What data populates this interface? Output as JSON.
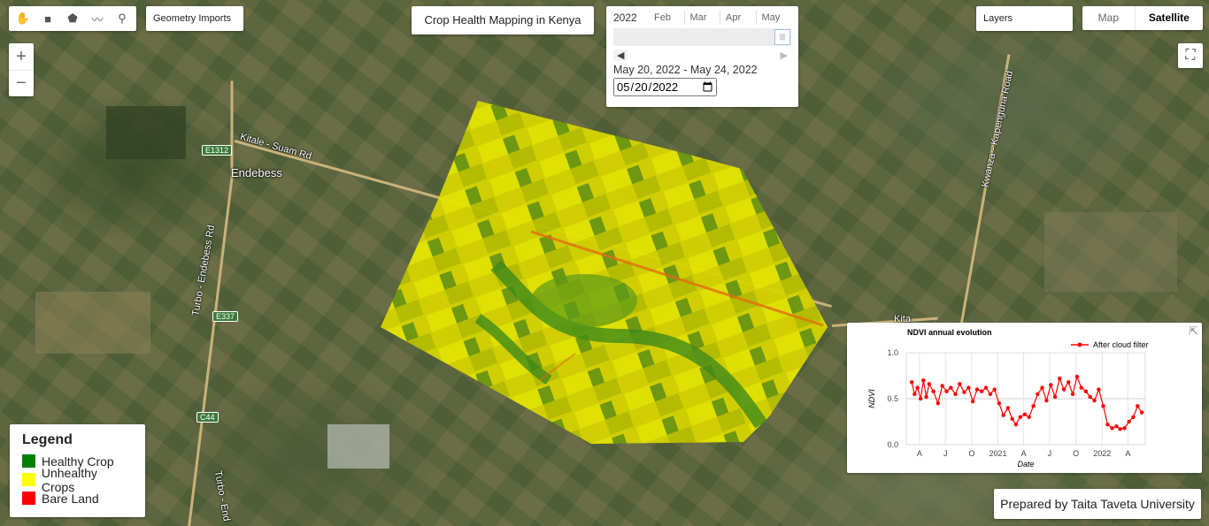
{
  "drawing_tools": {
    "tools": [
      {
        "name": "pan-hand-icon",
        "glyph": "✋"
      },
      {
        "name": "rectangle-icon",
        "glyph": "■"
      },
      {
        "name": "polygon-icon",
        "glyph": "⬟"
      },
      {
        "name": "line-icon",
        "glyph": "〰"
      },
      {
        "name": "marker-icon",
        "glyph": "⚲"
      }
    ],
    "imports_label": "Geometry Imports"
  },
  "title": "Crop Health Mapping in Kenya",
  "date_slider": {
    "year": "2022",
    "months": [
      "Feb",
      "Mar",
      "Apr",
      "May"
    ],
    "range_text": "May 20, 2022 - May 24, 2022",
    "date_value": "2022-05-20",
    "prev_glyph": "◀",
    "next_glyph": "▶",
    "handle_glyph": "|||"
  },
  "layers_label": "Layers",
  "map_type": {
    "map_label": "Map",
    "satellite_label": "Satellite",
    "selected": "Satellite"
  },
  "zoom": {
    "in_glyph": "+",
    "out_glyph": "−"
  },
  "fullscreen_glyph": "⛶",
  "map_labels": {
    "places": [
      "Endebess"
    ],
    "roads": [
      "Kitale - Suam Rd",
      "Turbo - Endebess Rd",
      "Kwanza - Kapenguria Road",
      "Kita",
      "Turbo - End"
    ],
    "shields": [
      "E1312",
      "E337",
      "C44"
    ]
  },
  "legend": {
    "title": "Legend",
    "items": [
      {
        "label": "Healthy Crop",
        "color": "#008000"
      },
      {
        "label": "Unhealthy Crops",
        "color": "#ffff00"
      },
      {
        "label": "Bare Land",
        "color": "#ff0000"
      }
    ]
  },
  "chart_panel": {
    "open_glyph": "⇱"
  },
  "chart_data": {
    "type": "line",
    "title": "NDVI annual evolution",
    "xlabel": "Date",
    "ylabel": "NDVI",
    "ylim": [
      0,
      1
    ],
    "yticks": [
      "0.0",
      "0.5",
      "1.0"
    ],
    "xticks": [
      "A",
      "J",
      "O",
      "2021",
      "A",
      "J",
      "O",
      "2022",
      "A"
    ],
    "series": [
      {
        "name": "After cloud filter",
        "color": "#ff0000",
        "x": [
          "2020-03-05",
          "2020-03-15",
          "2020-03-25",
          "2020-04-05",
          "2020-04-15",
          "2020-04-25",
          "2020-05-05",
          "2020-05-20",
          "2020-06-05",
          "2020-06-20",
          "2020-07-05",
          "2020-07-20",
          "2020-08-05",
          "2020-08-20",
          "2020-09-05",
          "2020-09-20",
          "2020-10-05",
          "2020-10-20",
          "2020-11-05",
          "2020-11-20",
          "2020-12-05",
          "2020-12-20",
          "2021-01-05",
          "2021-01-20",
          "2021-02-05",
          "2021-02-20",
          "2021-03-05",
          "2021-03-20",
          "2021-04-05",
          "2021-04-20",
          "2021-05-05",
          "2021-05-20",
          "2021-06-05",
          "2021-06-20",
          "2021-07-05",
          "2021-07-20",
          "2021-08-05",
          "2021-08-20",
          "2021-09-05",
          "2021-09-20",
          "2021-10-05",
          "2021-10-20",
          "2021-11-05",
          "2021-11-20",
          "2021-12-05",
          "2021-12-20",
          "2022-01-05",
          "2022-01-20",
          "2022-02-05",
          "2022-02-20",
          "2022-03-05",
          "2022-03-20",
          "2022-04-05",
          "2022-04-20",
          "2022-05-05",
          "2022-05-20"
        ],
        "y": [
          0.68,
          0.55,
          0.62,
          0.5,
          0.7,
          0.52,
          0.66,
          0.58,
          0.45,
          0.64,
          0.58,
          0.62,
          0.55,
          0.66,
          0.57,
          0.62,
          0.47,
          0.6,
          0.58,
          0.62,
          0.55,
          0.6,
          0.45,
          0.32,
          0.4,
          0.28,
          0.22,
          0.3,
          0.33,
          0.3,
          0.42,
          0.55,
          0.62,
          0.48,
          0.65,
          0.52,
          0.72,
          0.6,
          0.68,
          0.55,
          0.74,
          0.62,
          0.58,
          0.52,
          0.48,
          0.6,
          0.42,
          0.22,
          0.18,
          0.2,
          0.17,
          0.18,
          0.25,
          0.3,
          0.42,
          0.35
        ]
      }
    ]
  },
  "footer_credit": "Prepared by Taita Taveta University"
}
